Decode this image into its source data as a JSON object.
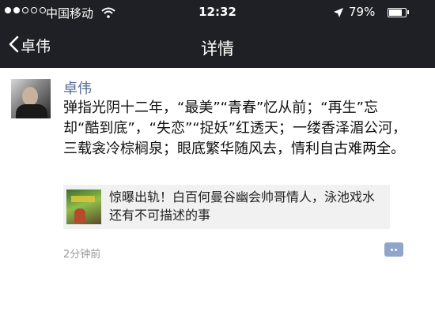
{
  "status_bar": {
    "carrier": "中国移动",
    "time": "12:32",
    "battery_percent": "79%",
    "battery_level": 0.79,
    "signal_bars": 2
  },
  "nav": {
    "back_label": "卓伟",
    "title": "详情"
  },
  "post": {
    "author": "卓伟",
    "text": "弹指光阴十二年，“最美”“青春”忆从前；“再生”忘却“酷到底”，“失恋”“捉妖”红透天；一缕香泽湄公河，三载衾冷棕榈泉；眼底繁华随风去，情利自古难两全。",
    "link_card_title": "惊曝出轨！白百何曼谷幽会帅哥情人，泳池戏水还有不可描述的事",
    "timestamp": "2分钟前"
  },
  "icons": {
    "back": "chevron-left-icon",
    "comment": "comment-icon",
    "wifi": "wifi-icon",
    "location": "location-arrow-icon",
    "battery": "battery-icon"
  }
}
